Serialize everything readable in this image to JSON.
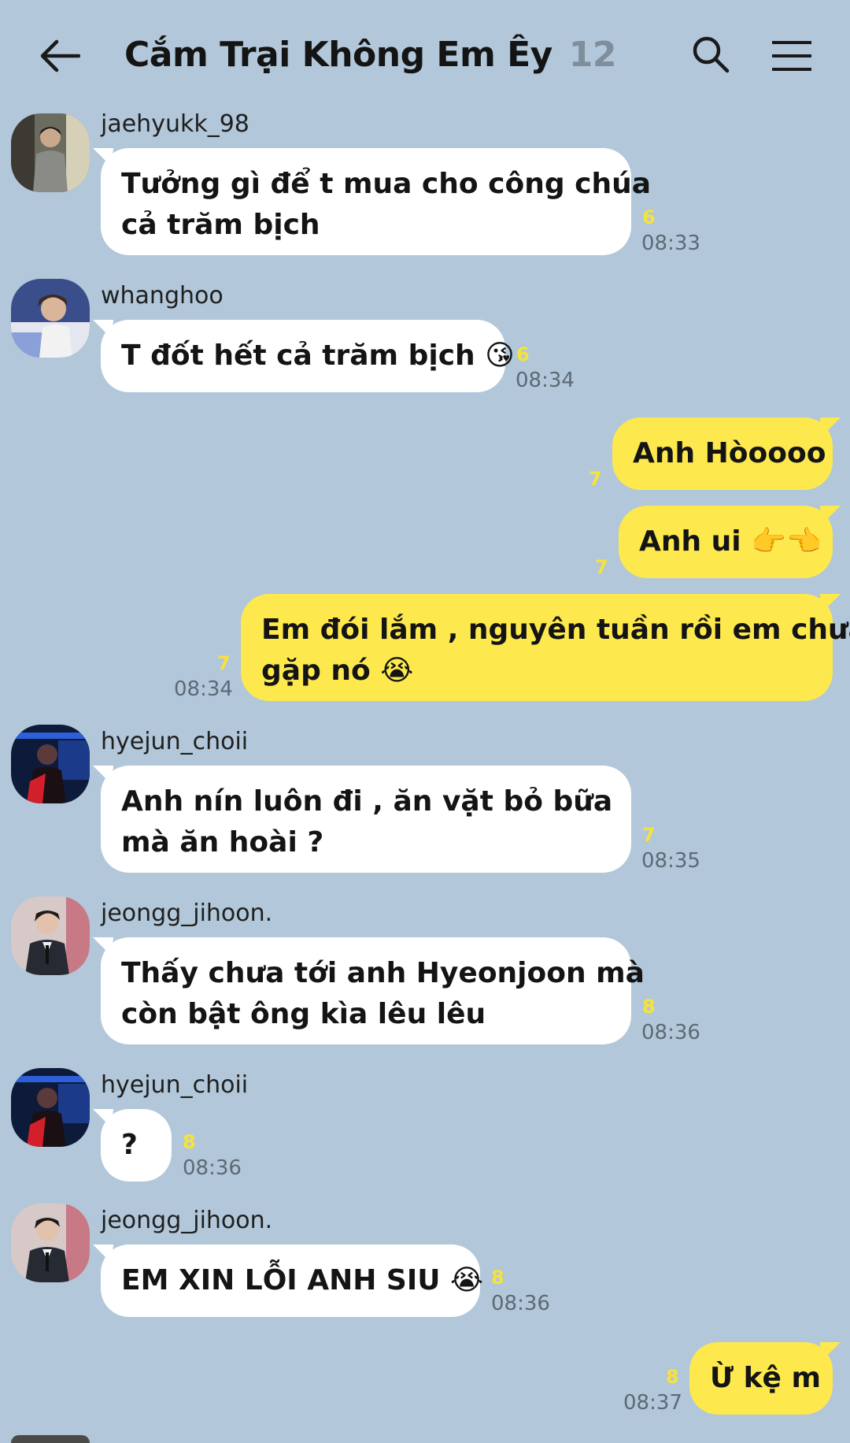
{
  "header": {
    "title": "Cắm Trại Không Em Êy",
    "member_count": "12"
  },
  "messages": [
    {
      "sender": "jaehyukk_98",
      "line1": "Tưởng gì để t mua cho công chúa",
      "line2": "cả trăm bịch",
      "unread": "6",
      "time": "08:33"
    },
    {
      "sender": "whanghoo",
      "text": "T đốt hết cả trăm bịch 😘",
      "unread": "6",
      "time": "08:34"
    },
    {
      "text": "Anh Hòoooo",
      "unread": "7"
    },
    {
      "text": "Anh ui 👉👈",
      "unread": "7"
    },
    {
      "line1": "Em đói lắm , nguyên tuần rồi em chưa",
      "line2": "gặp nó 😭",
      "unread": "7",
      "time": "08:34"
    },
    {
      "sender": "hyejun_choii",
      "line1": "Anh nín luôn đi , ăn vặt bỏ bữa",
      "line2": "mà ăn hoài ?",
      "unread": "7",
      "time": "08:35"
    },
    {
      "sender": "jeongg_jihoon.",
      "line1": "Thấy chưa tới anh Hyeonjoon mà",
      "line2": "còn bật ông kìa lêu lêu",
      "unread": "8",
      "time": "08:36"
    },
    {
      "sender": "hyejun_choii",
      "text": "?",
      "unread": "8",
      "time": "08:36"
    },
    {
      "sender": "jeongg_jihoon.",
      "text": "EM XIN LỖI ANH SIU 😭",
      "unread": "8",
      "time": "08:36"
    },
    {
      "text": "Ừ kệ m",
      "unread": "8",
      "time": "08:37"
    }
  ],
  "colors": {
    "background": "#b2c7d9",
    "incoming_bubble": "#ffffff",
    "outgoing_bubble": "#fde94d",
    "unread_count": "#f7e23a",
    "timestamp": "#5c6a75"
  },
  "icons": {
    "back": "arrow-left-icon",
    "search": "search-icon",
    "menu": "hamburger-menu-icon"
  }
}
